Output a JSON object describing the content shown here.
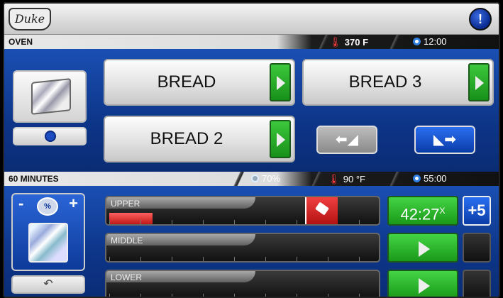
{
  "header": {
    "logo_text": "Duke",
    "alert_glyph": "!"
  },
  "oven_strip": {
    "label": "OVEN",
    "temperature": "370 F",
    "time": "12:00"
  },
  "recipes": [
    {
      "label": "BREAD"
    },
    {
      "label": "BREAD 3"
    },
    {
      "label": "BREAD 2"
    }
  ],
  "nav": {
    "prev_glyph": "⬅◢",
    "next_glyph": "◣➡"
  },
  "cycle_strip": {
    "label": "60 MINUTES",
    "humidity": "70%",
    "temperature": "90 °F",
    "time": "55:00"
  },
  "humidity_control": {
    "minus": "-",
    "plus": "+",
    "drop_label": "%",
    "undo_glyph": "↶"
  },
  "racks": [
    {
      "name": "UPPER",
      "timer": "42:27",
      "timer_suffix": "X",
      "add_label": "+5",
      "progress": 0.16
    },
    {
      "name": "MIDDLE"
    },
    {
      "name": "LOWER"
    }
  ],
  "colors": {
    "panel_blue": "#0d3588",
    "go_green": "#1a9a1a",
    "alert_red": "#c01818"
  }
}
